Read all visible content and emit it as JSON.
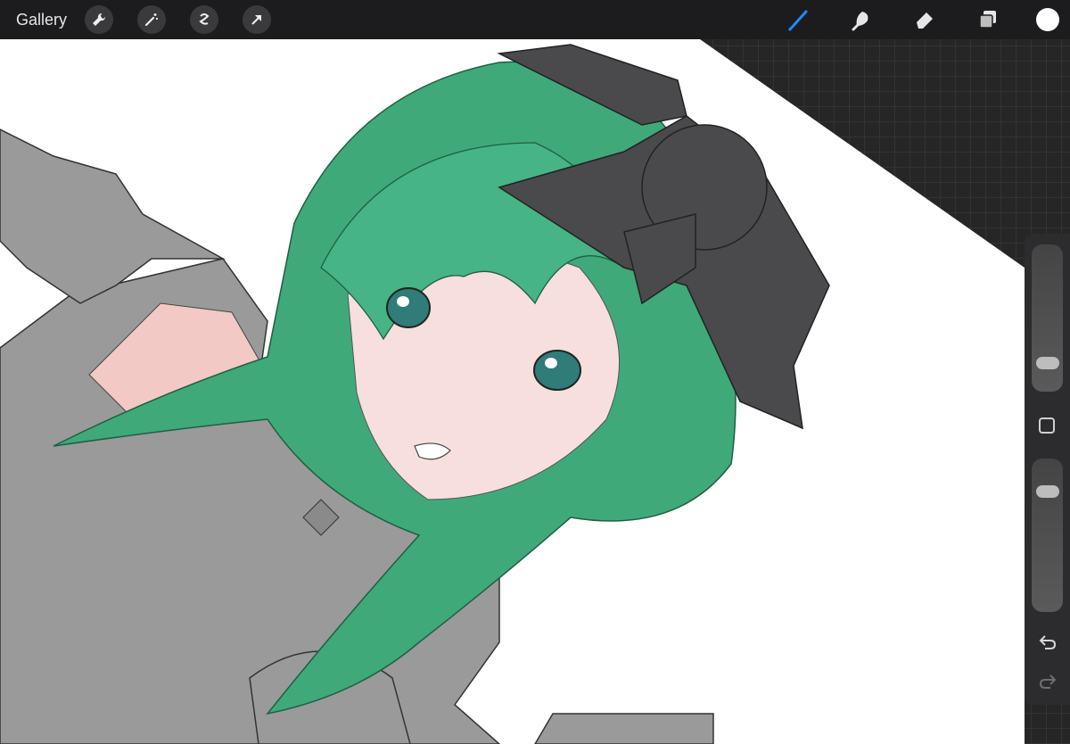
{
  "toolbar": {
    "gallery_label": "Gallery",
    "left_tools": [
      "wrench-icon",
      "magic-wand-icon",
      "selection-icon",
      "transform-arrow-icon"
    ],
    "right_tools": [
      "brush-icon",
      "smudge-icon",
      "eraser-icon",
      "layers-icon"
    ],
    "active_tool": "brush-icon",
    "active_color": "#ffffff",
    "accent": "#1e8bff"
  },
  "sidebar": {
    "controls": [
      "brush-size-slider",
      "modify-button",
      "opacity-slider",
      "undo-icon",
      "redo-icon"
    ]
  },
  "canvas": {
    "hair_color": "#3fa97a",
    "skin_color": "#f6dfdc",
    "clothing_color": "#9a9a9a",
    "bow_color": "#4a4a4d"
  }
}
